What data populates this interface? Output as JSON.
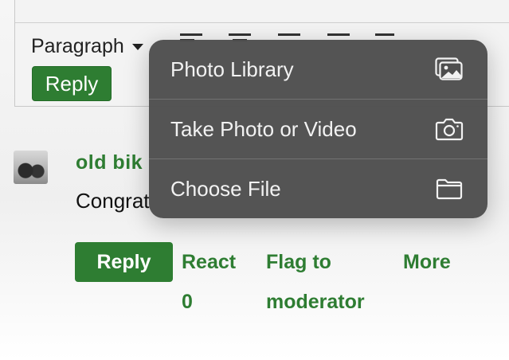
{
  "editor": {
    "format_label": "Paragraph",
    "reply_label": "Reply"
  },
  "post": {
    "username": "old bik",
    "text": "Congrat",
    "actions": {
      "reply": "Reply",
      "react": "React",
      "react_count": "0",
      "flag": "Flag to",
      "flag_line2": "moderator",
      "more": "More"
    }
  },
  "menu": {
    "items": [
      {
        "label": "Photo Library",
        "icon": "photo-library-icon"
      },
      {
        "label": "Take Photo or Video",
        "icon": "camera-icon"
      },
      {
        "label": "Choose File",
        "icon": "folder-icon"
      }
    ]
  },
  "colors": {
    "accent": "#2e7d32",
    "menu_bg": "#4e4e4e"
  }
}
